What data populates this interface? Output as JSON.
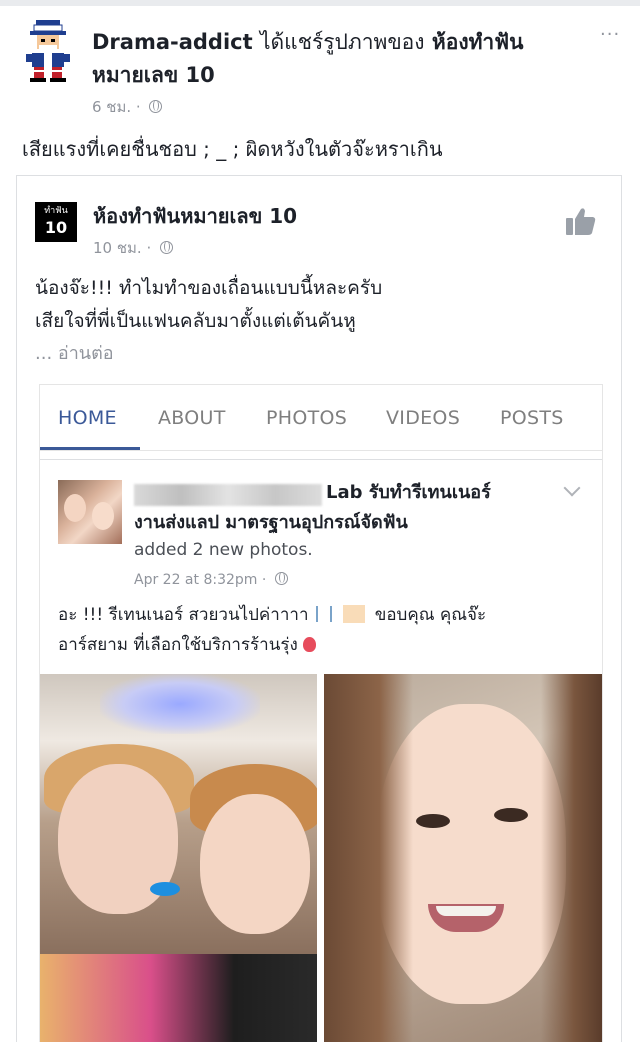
{
  "outer_post": {
    "author": "Drama-addict",
    "verb": "ได้แชร์รูปภาพของ",
    "shared_page": "ห้องทำฟันหมายเลข 10",
    "time": "6 ชม. ·",
    "caption": "เสียแรงที่เคยชื่นชอบ ; _ ;  ผิดหวังในตัวจ๊ะหราเกิน",
    "more_label": "···"
  },
  "shared_card": {
    "logo_top": "ทำฟัน",
    "logo_number": "10",
    "page_name": "ห้องทำฟันหมายเลข 10",
    "time": "10 ชม. ·",
    "text_line1": "น้องจ๊ะ!!! ทำไมทำของเถื่อนแบบนี้หละครับ",
    "text_line2": "เสียใจที่พี่เป็นแฟนคลับมาตั้งแต่เต้นคันหู",
    "read_more": "... อ่านต่อ"
  },
  "embedded_screenshot": {
    "tabs": [
      {
        "label": "HOME"
      },
      {
        "label": "ABOUT"
      },
      {
        "label": "PHOTOS"
      },
      {
        "label": "VIDEOS"
      },
      {
        "label": "POSTS"
      }
    ],
    "active_tab": "HOME",
    "post": {
      "name_line1": "Lab รับทำรีเทนเนอร์",
      "name_line2": "งานส่งแลป มาตรฐานอุปกรณ์จัดฟัน",
      "action": "added 2 new photos.",
      "time": "Apr 22 at 8:32pm ·",
      "text_part1": "อะ !!! รีเทนเนอร์ สวยวนไปค่าาาา",
      "text_part2": "ขอบคุณ คุณจ๊ะ",
      "text_line2": "อาร์สยาม ที่เลือกใช้บริการร้านรุ่ง"
    }
  },
  "colors": {
    "facebook_blue": "#3b5998",
    "meta_gray": "#90949c",
    "text": "#1d2129"
  }
}
